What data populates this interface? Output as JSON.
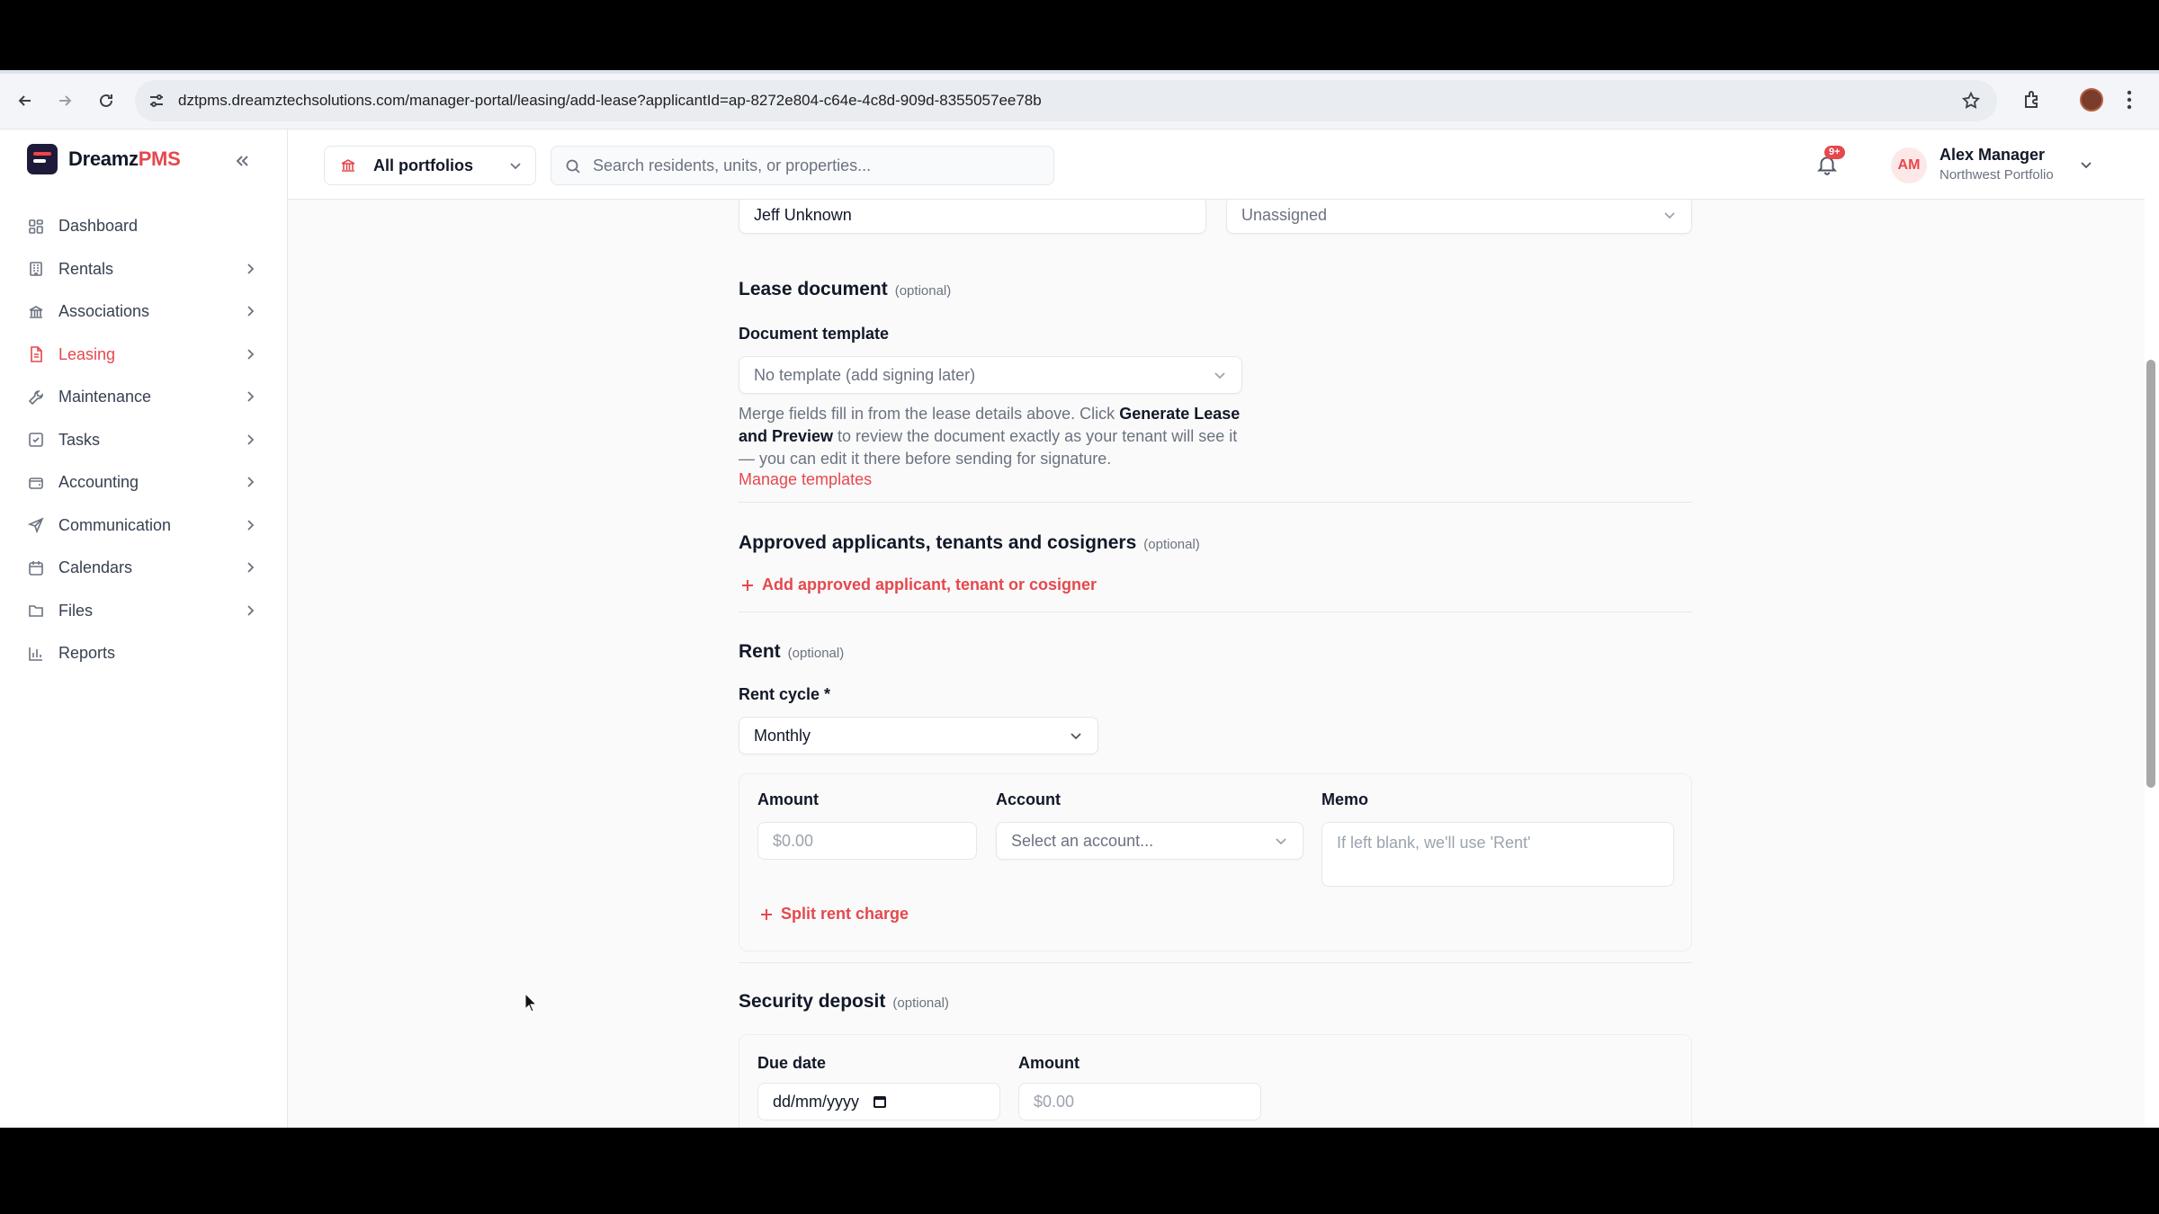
{
  "browser": {
    "url": "dztpms.dreamztechsolutions.com/manager-portal/leasing/add-lease?applicantId=ap-8272e804-c64e-4c8d-909d-8355057ee78b"
  },
  "app": {
    "brand_name": "Dreamz",
    "brand_accent": "PMS",
    "accent_color": "#e5484d"
  },
  "sidebar": {
    "items": [
      {
        "label": "Dashboard",
        "icon": "grid-icon"
      },
      {
        "label": "Rentals",
        "icon": "building-icon"
      },
      {
        "label": "Associations",
        "icon": "bank-icon"
      },
      {
        "label": "Leasing",
        "icon": "document-icon"
      },
      {
        "label": "Maintenance",
        "icon": "wrench-icon"
      },
      {
        "label": "Tasks",
        "icon": "checkbox-icon"
      },
      {
        "label": "Accounting",
        "icon": "wallet-icon"
      },
      {
        "label": "Communication",
        "icon": "send-icon"
      },
      {
        "label": "Calendars",
        "icon": "calendar-icon"
      },
      {
        "label": "Files",
        "icon": "folder-icon"
      },
      {
        "label": "Reports",
        "icon": "bar-chart-icon"
      }
    ],
    "active": "Leasing"
  },
  "topbar": {
    "portfolio": "All portfolios",
    "search_placeholder": "Search residents, units, or properties...",
    "notification_badge": "9+",
    "user_initials": "AM",
    "user_name": "Alex Manager",
    "user_subtitle": "Northwest Portfolio"
  },
  "form": {
    "tenant_name_value": "Jeff Unknown",
    "assignee_value": "Unassigned",
    "lease_document": {
      "title": "Lease document",
      "optional": "(optional)",
      "template_label": "Document template",
      "template_value": "No template (add signing later)",
      "help_pre": "Merge fields fill in from the lease details above. Click ",
      "help_bold": "Generate Lease and Preview",
      "help_post": " to review the document exactly as your tenant will see it — you can edit it there before sending for signature.",
      "manage_link": "Manage templates"
    },
    "applicants": {
      "title": "Approved applicants, tenants and cosigners",
      "optional": "(optional)",
      "add_link": "Add approved applicant, tenant or cosigner"
    },
    "rent": {
      "title": "Rent",
      "optional": "(optional)",
      "cycle_label": "Rent cycle *",
      "cycle_value": "Monthly",
      "amount_label": "Amount",
      "amount_placeholder": "$0.00",
      "account_label": "Account",
      "account_placeholder": "Select an account...",
      "memo_label": "Memo",
      "memo_placeholder": "If left blank, we'll use 'Rent'",
      "split_link": "Split rent charge"
    },
    "security_deposit": {
      "title": "Security deposit",
      "optional": "(optional)",
      "due_date_label": "Due date",
      "due_date_placeholder": "dd/mm/yyyy",
      "amount_label": "Amount",
      "amount_placeholder": "$0.00"
    }
  }
}
